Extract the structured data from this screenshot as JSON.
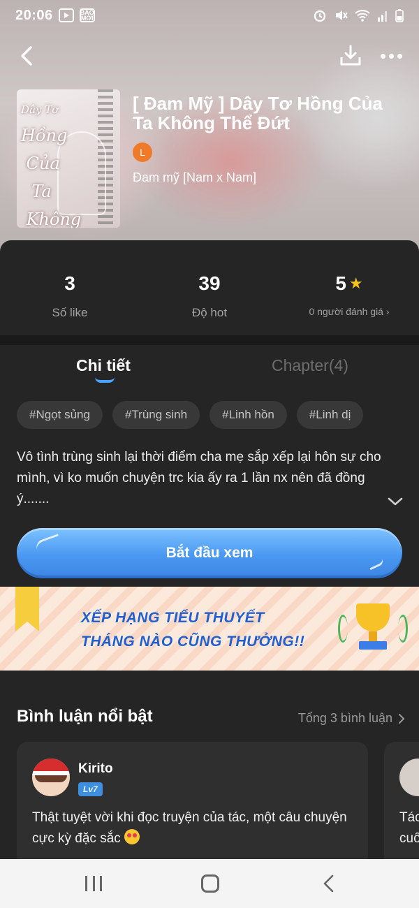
{
  "status_bar": {
    "time": "20:06",
    "left_icons": [
      "play-icon",
      "baomoi-icon"
    ],
    "baomoi_label": "BÁO MỚI",
    "right_icons": [
      "alarm-icon",
      "mute-icon",
      "wifi-icon",
      "signal-icon",
      "battery-icon"
    ]
  },
  "header": {
    "actions": [
      "back-icon",
      "download-icon",
      "more-icon"
    ]
  },
  "book": {
    "cover_title_top": "Dây Tơ",
    "cover_title_main": "Hồng\n Của\n  Ta\n Không\n   Thể Đứt",
    "title": "[ Đam Mỹ ] Dây Tơ Hồng Của Ta Không Thể Đứt",
    "author_initial": "L",
    "genre": "Đam mỹ [Nam x Nam]"
  },
  "stats": [
    {
      "value": "3",
      "label": "Số like"
    },
    {
      "value": "39",
      "label": "Độ hot"
    },
    {
      "value": "5",
      "label": "0 người đánh giá"
    }
  ],
  "tabs": {
    "detail": "Chi tiết",
    "chapter": "Chapter(4)"
  },
  "tags": [
    "#Ngọt sủng",
    "#Trùng sinh",
    "#Linh hồn",
    "#Linh dị"
  ],
  "description": "Vô tình trùng sinh lại thời điểm cha mẹ sắp xếp lại hôn sự cho mình, vì ko muốn chuyện trc kia ấy ra 1 lần nx nên đã đồng ý.......",
  "start_button": "Bắt đầu xem",
  "banner": {
    "line1": "XẾP HẠNG TIỂU THUYẾT",
    "line2": "THÁNG NÀO CŨNG THƯỞNG!!"
  },
  "comments": {
    "title": "Bình luận nổi bật",
    "total": "Tổng 3 bình luận",
    "items": [
      {
        "name": "Kirito",
        "level": "Lv7",
        "text": "Thật tuyệt vời khi đọc truyện của tác, một câu chuyện cực kỳ đặc sắc"
      },
      {
        "text": "Tác\ncuố"
      }
    ]
  },
  "colors": {
    "accent": "#4a98f2",
    "star": "#f6c21b",
    "author_avatar": "#ef7a2a",
    "sheet": "#252525"
  }
}
